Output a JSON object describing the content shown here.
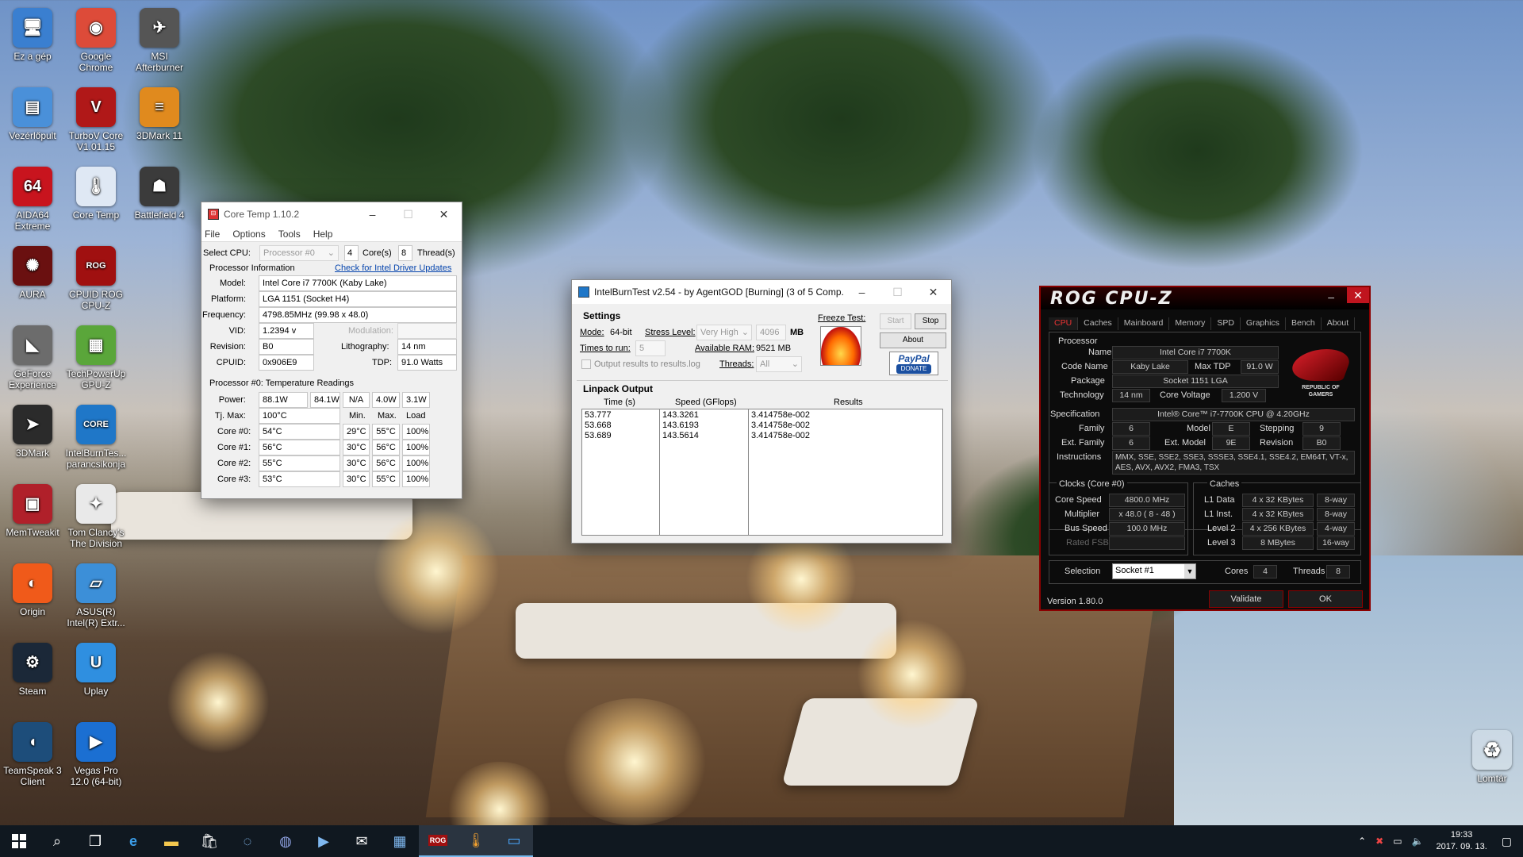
{
  "desktop_icons": [
    {
      "label": "Ez a gép",
      "icon": "pc-icon",
      "color": "#3a7fd0",
      "glyph": "🖥"
    },
    {
      "label": "Google Chrome",
      "icon": "chrome-icon",
      "color": "#dd4b39",
      "glyph": "◉"
    },
    {
      "label": "MSI Afterburner",
      "icon": "afterburner-icon",
      "color": "#555",
      "glyph": "✈"
    },
    {
      "label": "Vezérlőpult",
      "icon": "control-panel-icon",
      "color": "#4a90d9",
      "glyph": "▤"
    },
    {
      "label": "TurboV Core V1.01.15",
      "icon": "turbov-icon",
      "color": "#b01818",
      "glyph": "V"
    },
    {
      "label": "3DMark 11",
      "icon": "3dmark11-icon",
      "color": "#e08a1e",
      "glyph": "≡"
    },
    {
      "label": "AIDA64 Extreme",
      "icon": "aida64-icon",
      "color": "#c8141e",
      "glyph": "64"
    },
    {
      "label": "Core Temp",
      "icon": "coretemp-icon",
      "color": "#dfe8f4",
      "glyph": "🌡"
    },
    {
      "label": "Battlefield 4",
      "icon": "battlefield-icon",
      "color": "#3b3b3b",
      "glyph": "☗"
    },
    {
      "label": "AURA",
      "icon": "aura-icon",
      "color": "#6a1010",
      "glyph": "✺"
    },
    {
      "label": "CPUID ROG CPU-Z",
      "icon": "rog-cpuz-icon",
      "color": "#a01010",
      "glyph": "ROG"
    },
    {
      "label": "GeForce Experience",
      "icon": "geforce-icon",
      "color": "#6c6c6c",
      "glyph": "◣"
    },
    {
      "label": "TechPowerUp GPU-Z",
      "icon": "gpuz-icon",
      "color": "#5aa63a",
      "glyph": "▦"
    },
    {
      "label": "3DMark",
      "icon": "3dmark-icon",
      "color": "#2b2b2b",
      "glyph": "➤"
    },
    {
      "label": "IntelBurnTes... parancsikonja",
      "icon": "intelburntest-icon",
      "color": "#1f77c8",
      "glyph": "CORE"
    },
    {
      "label": "MemTweakit",
      "icon": "memtweakit-icon",
      "color": "#b0202a",
      "glyph": "▣"
    },
    {
      "label": "Tom Clancy's The Division",
      "icon": "division-icon",
      "color": "#e9e9e9",
      "glyph": "✦"
    },
    {
      "label": "Origin",
      "icon": "origin-icon",
      "color": "#f05a1a",
      "glyph": "◐"
    },
    {
      "label": "ASUS(R) Intel(R) Extr...",
      "icon": "asus-intel-icon",
      "color": "#3c8fd8",
      "glyph": "▱"
    },
    {
      "label": "Steam",
      "icon": "steam-icon",
      "color": "#1b2838",
      "glyph": "⚙"
    },
    {
      "label": "Uplay",
      "icon": "uplay-icon",
      "color": "#2f8fe0",
      "glyph": "U"
    },
    {
      "label": "TeamSpeak 3 Client",
      "icon": "teamspeak-icon",
      "color": "#1d4d7a",
      "glyph": "◖"
    },
    {
      "label": "Vegas Pro 12.0 (64-bit)",
      "icon": "vegas-icon",
      "color": "#1b6fd2",
      "glyph": "▶"
    }
  ],
  "recycle_bin": {
    "label": "Lomtár",
    "icon": "recycle-bin-icon"
  },
  "coretemp": {
    "title": "Core Temp 1.10.2",
    "menu": [
      "File",
      "Options",
      "Tools",
      "Help"
    ],
    "select_cpu_label": "Select CPU:",
    "processor": "Processor #0",
    "cores_value": "4",
    "cores_label": "Core(s)",
    "threads_value": "8",
    "threads_label": "Thread(s)",
    "proc_info_label": "Processor Information",
    "driver_link": "Check for Intel Driver Updates",
    "model_label": "Model:",
    "model": "Intel Core i7 7700K (Kaby Lake)",
    "platform_label": "Platform:",
    "platform": "LGA 1151 (Socket H4)",
    "frequency_label": "Frequency:",
    "frequency": "4798.85MHz (99.98 x 48.0)",
    "vid_label": "VID:",
    "vid": "1.2394 v",
    "modulation_label": "Modulation:",
    "revision_label": "Revision:",
    "revision": "B0",
    "litho_label": "Lithography:",
    "litho": "14 nm",
    "cpuid_label": "CPUID:",
    "cpuid": "0x906E9",
    "tdp_label": "TDP:",
    "tdp": "91.0 Watts",
    "temp_header": "Processor #0: Temperature Readings",
    "power_label": "Power:",
    "power": [
      "88.1W",
      "84.1W",
      "N/A",
      "4.0W",
      "3.1W"
    ],
    "tjmax_label": "Tj. Max:",
    "tjmax": "100°C",
    "col_min": "Min.",
    "col_max": "Max.",
    "col_load": "Load",
    "cores": [
      {
        "label": "Core #0:",
        "temp": "54°C",
        "min": "29°C",
        "max": "55°C",
        "load": "100%"
      },
      {
        "label": "Core #1:",
        "temp": "56°C",
        "min": "30°C",
        "max": "56°C",
        "load": "100%"
      },
      {
        "label": "Core #2:",
        "temp": "55°C",
        "min": "30°C",
        "max": "56°C",
        "load": "100%"
      },
      {
        "label": "Core #3:",
        "temp": "53°C",
        "min": "30°C",
        "max": "55°C",
        "load": "100%"
      }
    ]
  },
  "ibt": {
    "title": "IntelBurnTest v2.54 - by AgentGOD [Burning] (3 of 5 Comp...",
    "settings_label": "Settings",
    "mode_label": "Mode:",
    "mode": "64-bit",
    "stress_label": "Stress Level:",
    "stress": "Very High",
    "mb_value": "4096",
    "mb_unit": "MB",
    "times_label": "Times to run:",
    "times": "5",
    "ram_label": "Available RAM:",
    "ram": "9521 MB",
    "output_check": "Output results to results.log",
    "threads_label": "Threads:",
    "threads": "All",
    "freeze_label": "Freeze Test:",
    "start": "Start",
    "stop": "Stop",
    "about": "About",
    "paypal": "PayPal",
    "donate": "DONATE",
    "linpack_label": "Linpack Output",
    "col_time": "Time (s)",
    "col_speed": "Speed (GFlops)",
    "col_results": "Results",
    "times_col": [
      "53.777",
      "53.668",
      "53.689"
    ],
    "speeds_col": [
      "143.3261",
      "143.6193",
      "143.5614"
    ],
    "results_col": [
      "3.414758e-002",
      "3.414758e-002",
      "3.414758e-002"
    ]
  },
  "cpuz": {
    "title": "ROG CPU-Z",
    "tabs": [
      "CPU",
      "Caches",
      "Mainboard",
      "Memory",
      "SPD",
      "Graphics",
      "Bench",
      "About"
    ],
    "processor_label": "Processor",
    "name_label": "Name",
    "name": "Intel Core i7 7700K",
    "codename_label": "Code Name",
    "codename": "Kaby Lake",
    "maxtdp_label": "Max TDP",
    "maxtdp": "91.0 W",
    "package_label": "Package",
    "package": "Socket 1151 LGA",
    "tech_label": "Technology",
    "tech": "14 nm",
    "voltage_label": "Core Voltage",
    "voltage": "1.200 V",
    "spec_label": "Specification",
    "spec": "Intel® Core™ i7-7700K CPU @ 4.20GHz",
    "family_label": "Family",
    "family": "6",
    "model_label": "Model",
    "model": "E",
    "stepping_label": "Stepping",
    "stepping": "9",
    "extfamily_label": "Ext. Family",
    "extfamily": "6",
    "extmodel_label": "Ext. Model",
    "extmodel": "9E",
    "revision_label": "Revision",
    "revision": "B0",
    "instr_label": "Instructions",
    "instr": "MMX, SSE, SSE2, SSE3, SSSE3, SSE4.1, SSE4.2, EM64T, VT-x, AES, AVX, AVX2, FMA3, TSX",
    "clocks_label": "Clocks (Core #0)",
    "corespeed_label": "Core Speed",
    "corespeed": "4800.0 MHz",
    "multiplier_label": "Multiplier",
    "multiplier": "x 48.0 ( 8 - 48 )",
    "busspeed_label": "Bus Speed",
    "busspeed": "100.0 MHz",
    "ratedfsb_label": "Rated FSB",
    "caches_label": "Caches",
    "l1d_label": "L1 Data",
    "l1d": "4 x 32 KBytes",
    "l1d_way": "8-way",
    "l1i_label": "L1 Inst.",
    "l1i": "4 x 32 KBytes",
    "l1i_way": "8-way",
    "l2_label": "Level 2",
    "l2": "4 x 256 KBytes",
    "l2_way": "4-way",
    "l3_label": "Level 3",
    "l3": "8 MBytes",
    "l3_way": "16-way",
    "selection_label": "Selection",
    "selection": "Socket #1",
    "cores_label": "Cores",
    "cores": "4",
    "threads_label": "Threads",
    "threads": "8",
    "version": "Version 1.80.0",
    "validate": "Validate",
    "ok": "OK",
    "rog_badge": "REPUBLIC OF GAMERS"
  },
  "taskbar": {
    "clock_time": "19:33",
    "clock_date": "2017. 09. 13."
  }
}
